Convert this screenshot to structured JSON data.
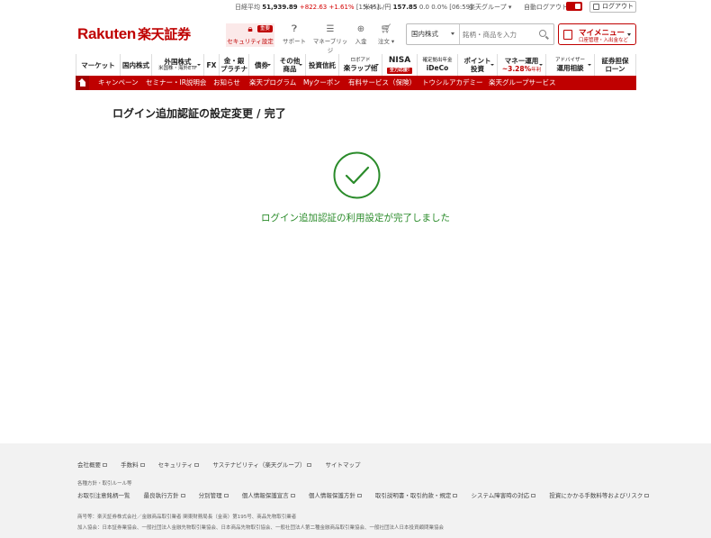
{
  "ticker": {
    "nikkei_label": "日経平均",
    "nikkei_value": "51,939.89",
    "nikkei_change": "+822.63 +1.61%",
    "nikkei_time": "[15:45]",
    "usdjpy_label": "米ドル/円",
    "usdjpy_value": "157.85",
    "usdjpy_change": "0.0 0.0%",
    "usdjpy_time": "[06:59]",
    "group_label": "楽天グループ",
    "auto_logout_label": "自動ログアウト",
    "logout_label": "ログアウト"
  },
  "header": {
    "logo_latin": "Rakuten",
    "logo_jp": "楽天証券",
    "icons": [
      {
        "label": "セキュリティ設定",
        "badge": "重要",
        "icon": "lock-icon"
      },
      {
        "label": "サポート",
        "icon": "support-chat-icon"
      },
      {
        "label": "マネーブリッジ",
        "icon": "bridge-icon"
      },
      {
        "label": "入金",
        "icon": "deposit-icon"
      },
      {
        "label": "注文",
        "icon": "cart-icon"
      }
    ],
    "search_select": "国内株式",
    "search_placeholder": "銘柄・商品を入力",
    "mymenu_title": "マイメニュー",
    "mymenu_sub": "口座管理・入出金など"
  },
  "product_nav": [
    {
      "label": "マーケット"
    },
    {
      "label": "国内株式"
    },
    {
      "label": "外国株式",
      "sub": "米国株・海外ETF"
    },
    {
      "label": "FX"
    },
    {
      "label": "金・銀",
      "label2": "プラチナ"
    },
    {
      "label": "債券"
    },
    {
      "label": "その他",
      "label2": "商品"
    },
    {
      "label": "投資信託"
    },
    {
      "label": "ロボアド",
      "label2": "楽ラップ他"
    },
    {
      "label": "NISA",
      "tag": "全力応援!"
    },
    {
      "label": "確定拠出年金",
      "label2": "iDeCo"
    },
    {
      "label": "ポイント",
      "label2": "投資"
    },
    {
      "label": "マネー運用",
      "label2": "~3.28%",
      "label3": "年利"
    },
    {
      "label": "アドバイザー",
      "label2": "運用相談"
    },
    {
      "label": "証券担保",
      "label2": "ローン"
    }
  ],
  "red_nav": [
    "キャンペーン",
    "セミナー・IR説明会",
    "お知らせ",
    "楽天プログラム",
    "Myクーポン",
    "有料サービス（保険）",
    "トウシルアカデミー",
    "楽天グループサービス"
  ],
  "main": {
    "title": "ログイン追加認証の設定変更 / 完了",
    "message": "ログイン追加認証の利用設定が完了しました",
    "success_color": "#2a8b2a"
  },
  "footer": {
    "row1": [
      "会社概要",
      "手数料",
      "セキュリティ",
      "サステナビリティ（楽天グループ）",
      "サイトマップ"
    ],
    "policies_heading": "各種方針・取引ルール等",
    "row2": [
      "お取引注意銘柄一覧",
      "最良執行方針",
      "分別管理",
      "個人情報保護宣言",
      "個人情報保護方針",
      "取引説明書・取引約款・規定",
      "システム障害時の対応",
      "投資にかかる手数料等およびリスク"
    ],
    "registration": "商号等：楽天証券株式会社／金融商品取引業者 関東財務局長（金商）第195号、商品先物取引業者",
    "associations": "加入協会：日本証券業協会、一般社団法人金融先物取引業協会、日本商品先物取引協会、一般社団法人第二種金融商品取引業協会、一般社団法人日本投資顧問業協会"
  },
  "colors": {
    "brand": "#bf0000",
    "success": "#2a8b2a"
  }
}
